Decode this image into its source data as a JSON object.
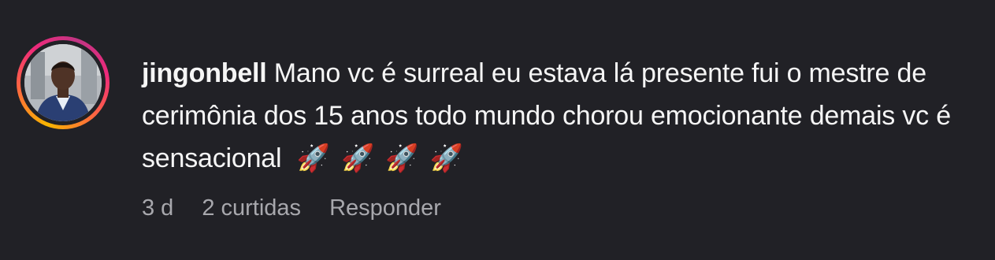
{
  "comment": {
    "username": "jingonbell",
    "text": "Mano vc é surreal eu estava lá presente fui o mestre de cerimônia dos 15 anos todo mundo chorou emocionante demais vc é sensacional",
    "emojis": "🚀🚀🚀🚀",
    "time": "3 d",
    "likes": "2 curtidas",
    "reply_label": "Responder",
    "avatar_icon": "profile-photo"
  }
}
